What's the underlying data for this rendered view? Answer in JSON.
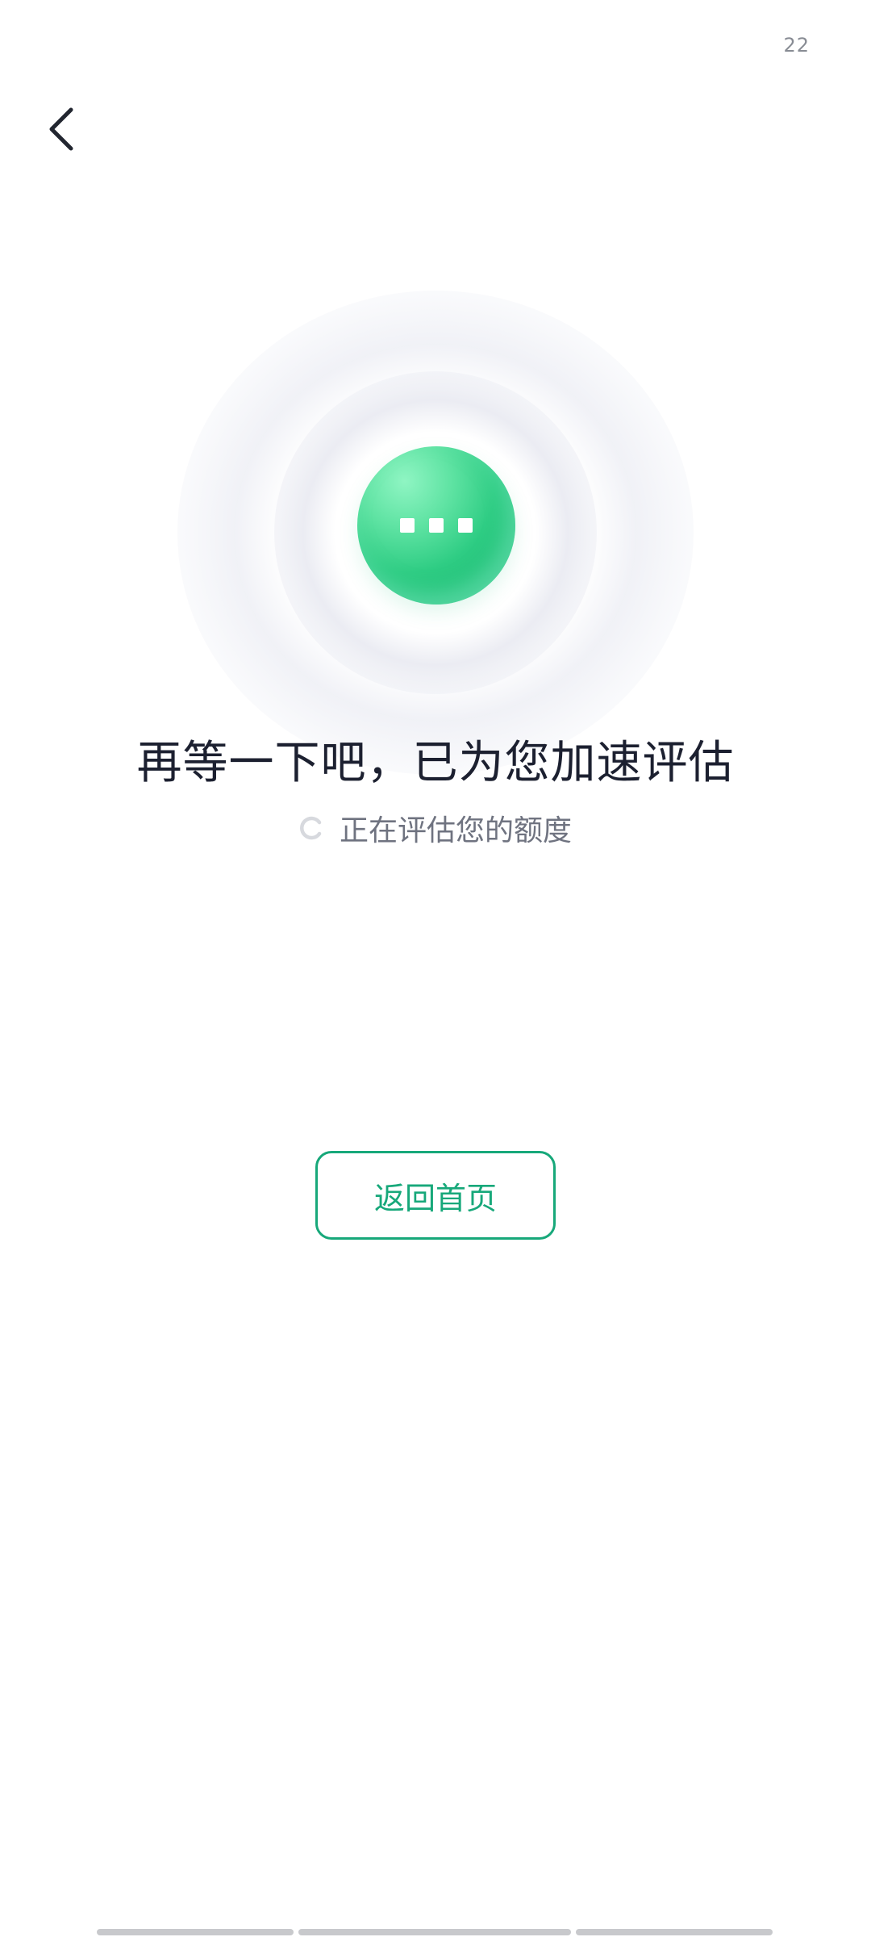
{
  "status_bar": {
    "time": "22"
  },
  "header": {
    "back_icon": "chevron-left-icon"
  },
  "hero": {
    "orb_icon": "more-dots-icon",
    "orb_color": "#2fcd84"
  },
  "content": {
    "title": "再等一下吧，已为您加速评估",
    "subtitle": "正在评估您的额度",
    "spinner_icon": "loading-spinner-icon"
  },
  "actions": {
    "home_label": "返回首页",
    "accent_color": "#17a87a"
  }
}
